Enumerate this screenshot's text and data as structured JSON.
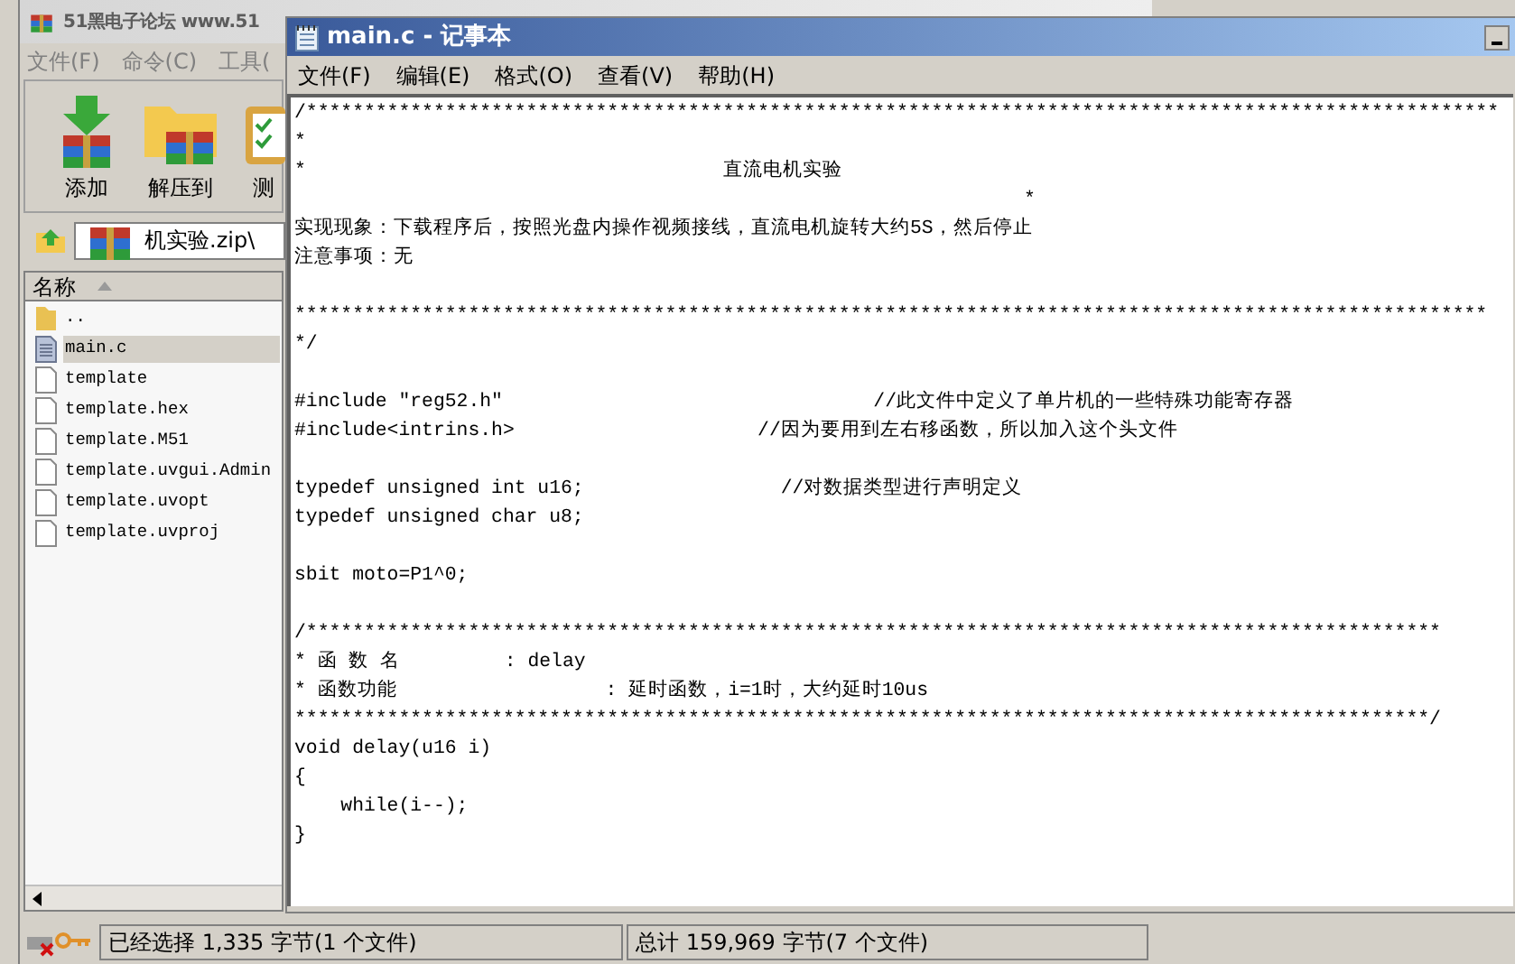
{
  "background_window": {
    "title": "51黑电子论坛 www.51",
    "menu": [
      "文件(F)",
      "命令(C)",
      "工具("
    ],
    "toolbar": [
      {
        "label": "添加",
        "kind": "add"
      },
      {
        "label": "解压到",
        "kind": "extract"
      },
      {
        "label": "测",
        "kind": "test"
      }
    ],
    "path": "机实验.zip\\",
    "columns": [
      {
        "label": "名称",
        "sorted": true
      }
    ],
    "files": [
      {
        "name": "..",
        "kind": "folder",
        "selected": false
      },
      {
        "name": "main.c",
        "kind": "text",
        "selected": true
      },
      {
        "name": "template",
        "kind": "file",
        "selected": false
      },
      {
        "name": "template.hex",
        "kind": "file",
        "selected": false
      },
      {
        "name": "template.M51",
        "kind": "file",
        "selected": false
      },
      {
        "name": "template.uvgui.Admin",
        "kind": "file",
        "selected": false
      },
      {
        "name": "template.uvopt",
        "kind": "file",
        "selected": false
      },
      {
        "name": "template.uvproj",
        "kind": "file",
        "selected": false
      }
    ],
    "status": {
      "selection": "已经选择 1,335 字节(1 个文件)",
      "total": "总计 159,969 字节(7 个文件)"
    }
  },
  "notepad": {
    "title": "main.c - 记事本",
    "menu": [
      "文件(F)",
      "编辑(E)",
      "格式(O)",
      "查看(V)",
      "帮助(H)"
    ],
    "blocks": [
      [
        "/*******************************************************************************************************",
        "*",
        "*                                    直流电机实验",
        "                                                               *",
        "实现现象：下载程序后，按照光盘内操作视频接线，直流电机旋转大约5S，然后停止",
        "注意事项：无"
      ],
      [
        "*******************************************************************************************************",
        "*/"
      ],
      [
        "#include \"reg52.h\"                                //此文件中定义了单片机的一些特殊功能寄存器",
        "#include<intrins.h>                     //因为要用到左右移函数，所以加入这个头文件"
      ],
      [
        "typedef unsigned int u16;                 //对数据类型进行声明定义",
        "typedef unsigned char u8;"
      ],
      [
        "sbit moto=P1^0;"
      ],
      [
        "/**************************************************************************************************",
        "* 函 数 名         : delay",
        "* 函数功能                  : 延时函数，i=1时，大约延时10us",
        "**************************************************************************************************/",
        "void delay(u16 i)",
        "{",
        "\twhile(i--);",
        "}"
      ]
    ]
  }
}
